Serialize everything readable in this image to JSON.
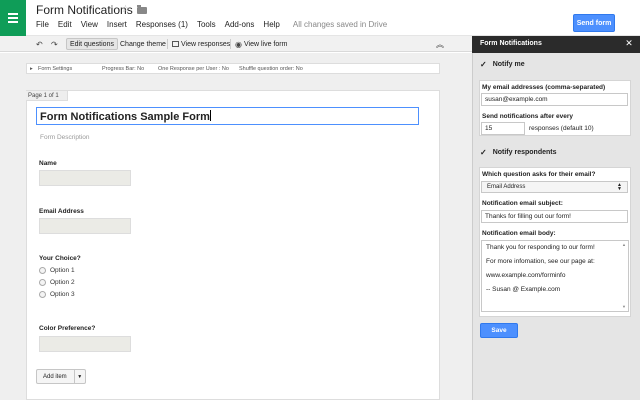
{
  "header": {
    "title": "Form Notifications",
    "menu": [
      "File",
      "Edit",
      "View",
      "Insert",
      "Responses (1)",
      "Tools",
      "Add-ons",
      "Help"
    ],
    "save_status": "All changes saved in Drive",
    "send_label": "Send form"
  },
  "toolbar": {
    "edit_questions": "Edit questions",
    "change_theme": "Change theme",
    "view_responses": "View responses",
    "view_live_form": "View live form"
  },
  "form_settings": {
    "label": "Form Settings",
    "progress_bar": "Progress Bar: No",
    "one_response": "One Response per User : No",
    "shuffle": "Shuffle question order: No"
  },
  "form": {
    "page_label": "Page 1 of 1",
    "title": "Form Notifications Sample Form",
    "description_placeholder": "Form Description",
    "questions": [
      {
        "label": "Name"
      },
      {
        "label": "Email Address"
      },
      {
        "label": "Your Choice?",
        "options": [
          "Option 1",
          "Option 2",
          "Option 3"
        ]
      },
      {
        "label": "Color Preference?"
      }
    ],
    "add_item_label": "Add item"
  },
  "panel": {
    "title": "Form Notifications",
    "notify_me": "Notify me",
    "emails_label": "My email addresses (comma-separated)",
    "emails_value": "susan@example.com",
    "frequency_label": "Send notifications after every",
    "frequency_value": "15",
    "frequency_suffix": "responses (default 10)",
    "notify_respondents": "Notify respondents",
    "which_question_label": "Which question asks for their email?",
    "which_question_value": "Email Address",
    "subject_label": "Notification email subject:",
    "subject_value": "Thanks for filling out our form!",
    "body_label": "Notification email body:",
    "body_lines": [
      "Thank you for responding to our form!",
      "For more infomation, see our page at:",
      "www.example.com/forminfo",
      "-- Susan @ Example.com"
    ],
    "save_label": "Save"
  },
  "colors": {
    "accent": "#4d90fe",
    "forms_green": "#0f9d58",
    "panel_header": "#2b2b2b"
  }
}
